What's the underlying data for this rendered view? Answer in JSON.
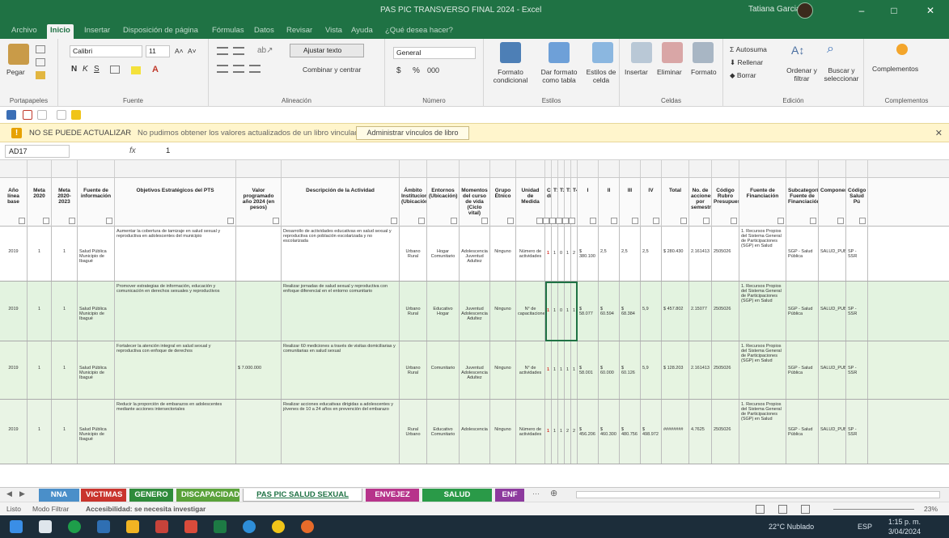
{
  "app": {
    "window_title": "PAS PIC TRANSVERSO FINAL 2024 - Excel",
    "user_name": "Tatiana Garcia",
    "window_controls": [
      "–",
      "□",
      "✕"
    ]
  },
  "ribbon_tabs": [
    "Archivo",
    "Inicio",
    "Insertar",
    "Disposición de página",
    "Fórmulas",
    "Datos",
    "Revisar",
    "Vista",
    "Ayuda",
    "¿Qué desea hacer?"
  ],
  "ribbon": {
    "clipboard": {
      "paste": "Pegar",
      "label": "Portapapeles"
    },
    "font": {
      "name": "Calibri",
      "size": "11",
      "bold": "N",
      "italic": "K",
      "underline": "S",
      "label": "Fuente"
    },
    "alignment": {
      "wrap": "Ajustar texto",
      "merge": "Combinar y centrar",
      "label": "Alineación"
    },
    "number": {
      "format": "General",
      "currency": "$",
      "percent": "%",
      "thousands": "000",
      "label": "Número"
    },
    "styles": {
      "conditional": "Formato condicional",
      "as_table": "Dar formato como tabla",
      "cell_styles": "Estilos de celda",
      "label": "Estilos"
    },
    "cells": {
      "insert": "Insertar",
      "delete": "Eliminar",
      "format": "Formato",
      "label": "Celdas"
    },
    "editing": {
      "autosum": "Autosuma",
      "fill": "Rellenar",
      "clear": "Borrar",
      "sort": "Ordenar y filtrar",
      "find": "Buscar y seleccionar",
      "label": "Edición"
    },
    "addins": {
      "button": "Complementos",
      "label": "Complementos"
    }
  },
  "warning": {
    "title": "NO SE PUEDE ACTUALIZAR",
    "message": "No pudimos obtener los valores actualizados de un libro vinculado.",
    "button": "Administrar vínculos de libro"
  },
  "formula_bar": {
    "cell_ref": "AD17",
    "fx": "fx",
    "value": "1"
  },
  "columns": [
    {
      "header": "Año línea base"
    },
    {
      "header": "Meta 2020"
    },
    {
      "header": "Meta 2020-2023"
    },
    {
      "header": "Fuente de información"
    },
    {
      "header": "Objetivos Estratégicos del PTS"
    },
    {
      "header": "Valor programado año 2024 (en pesos)"
    },
    {
      "header": "Descripción de la Actividad"
    },
    {
      "header": "Ámbito Institucional (Ubicación)"
    },
    {
      "header": "Entornos (Ubicación)"
    },
    {
      "header": "Momentos del curso de vida (Ciclo vital)"
    },
    {
      "header": "Grupo Étnico"
    },
    {
      "header": "Unidad de Medida"
    },
    {
      "header": "Cant. día"
    },
    {
      "header": "T1"
    },
    {
      "header": "T2"
    },
    {
      "header": "T3"
    },
    {
      "header": "T4"
    },
    {
      "header": "I"
    },
    {
      "header": "II"
    },
    {
      "header": "III"
    },
    {
      "header": "IV"
    },
    {
      "header": "Total"
    },
    {
      "header": "No. de acciones por semestre"
    },
    {
      "header": "Código Rubro Presupuestal"
    },
    {
      "header": "Fuente de Financiación"
    },
    {
      "header": "Subcategoría Fuente de Financiación"
    },
    {
      "header": "Componente"
    },
    {
      "header": "Código Salud Pú"
    }
  ],
  "rows": [
    {
      "year": "2019",
      "meta": "1",
      "meta2": "1",
      "source": "Salud Pública Municipio de Ibagué",
      "objective": "Aumentar la cobertura de tamizaje en salud sexual y reproductiva en adolescentes del municipio",
      "value": "",
      "activity": "Desarrollo de actividades educativas en salud sexual y reproductiva con población escolarizada y no escolarizada",
      "ambit": "Urbano Rural",
      "env": "Hogar Comunitario",
      "life": "Adolescencia Juventud Adultez",
      "ethnic": "Ninguno",
      "unit": "Número de actividades",
      "red": "1",
      "q": [
        "1",
        "0",
        "1",
        "2"
      ],
      "i": "$ 380.100",
      "ii": "2,5",
      "iii": "2,5",
      "iv": "2,5",
      "total": "$ 280.430",
      "acc": "2.161413",
      "code": "2505026",
      "fund": "1. Recursos Propios del Sistema General de Participaciones (SGP) en Salud",
      "sub": "SGP - Salud Pública",
      "comp": "SALUD_PUBLICA",
      "cod": "SP - SSR"
    },
    {
      "year": "2019",
      "meta": "1",
      "meta2": "1",
      "source": "Salud Pública Municipio de Ibagué",
      "objective": "Promover estrategias de información, educación y comunicación en derechos sexuales y reproductivos",
      "value": "",
      "activity": "Realizar jornadas de salud sexual y reproductiva con enfoque diferencial en el entorno comunitario",
      "ambit": "Urbano Rural",
      "env": "Educativo Hogar",
      "life": "Juventud Adolescencia Adultez",
      "ethnic": "Ninguno",
      "unit": "N° de capacitaciones",
      "red": "1",
      "q": [
        "1",
        "0",
        "1",
        "1"
      ],
      "i": "$ 58.077",
      "ii": "$ 60.594",
      "iii": "$ 68.384",
      "iv": "5,9",
      "total": "$ 457.802",
      "acc": "2.15077",
      "code": "2505026",
      "fund": "1. Recursos Propios del Sistema General de Participaciones (SGP) en Salud",
      "sub": "SGP - Salud Pública",
      "comp": "SALUD_PUBLICA",
      "cod": "SP - SSR"
    },
    {
      "year": "2019",
      "meta": "1",
      "meta2": "1",
      "source": "Salud Pública Municipio de Ibagué",
      "objective": "Fortalecer la atención integral en salud sexual y reproductiva con enfoque de derechos",
      "value": "$ 7.000.000",
      "activity": "Realizar 60 mediciones a través de visitas domiciliarias y comunitarias en salud sexual",
      "ambit": "Urbano Rural",
      "env": "Comunitario",
      "life": "Juventud Adolescencia Adultez",
      "ethnic": "Ninguno",
      "unit": "N° de actividades",
      "red": "1",
      "q": [
        "1",
        "1",
        "1",
        "1"
      ],
      "i": "$ 58.001",
      "ii": "$ 60.000",
      "iii": "$ 60.126",
      "iv": "5,9",
      "total": "$ 128.203",
      "acc": "2.161413",
      "code": "2505026",
      "fund": "1. Recursos Propios del Sistema General de Participaciones (SGP) en Salud",
      "sub": "SGP - Salud Pública",
      "comp": "SALUD_PUBLICA",
      "cod": "SP - SSR"
    },
    {
      "year": "2019",
      "meta": "1",
      "meta2": "1",
      "source": "Salud Pública Municipio de Ibagué",
      "objective": "Reducir la proporción de embarazos en adolescentes mediante acciones intersectoriales",
      "value": "",
      "activity": "Realizar acciones educativas dirigidas a adolescentes y jóvenes de 10 a 24 años en prevención del embarazo",
      "ambit": "Rural Urbano",
      "env": "Educativo Comunitario",
      "life": "Adolescencia",
      "ethnic": "Ninguno",
      "unit": "Número de actividades",
      "red": "1",
      "q": [
        "1",
        "1",
        "2",
        "2"
      ],
      "i": "$ 456.206",
      "ii": "$ 460.300",
      "iii": "$ 480.756",
      "iv": "$ 498.972",
      "total": "########",
      "acc": "4.7625",
      "code": "2505026",
      "fund": "1. Recursos Propios del Sistema General de Participaciones (SGP) en Salud",
      "sub": "SGP - Salud Pública",
      "comp": "SALUD_PUBLICA",
      "cod": "SP - SSR"
    }
  ],
  "red_text_note": "DESPROGRAMADA JEFE DANIELA",
  "sheet_tabs": [
    {
      "label": "NNA",
      "color": "#4a8fc9"
    },
    {
      "label": "VICTIMAS",
      "color": "#c9342d"
    },
    {
      "label": "GENERO",
      "color": "#2f8b3b"
    },
    {
      "label": "DISCAPACIDAD",
      "color": "#5aa23a"
    },
    {
      "label": "PAS PIC SALUD SEXUAL",
      "color": "#ffffff"
    },
    {
      "label": "ENVEJEZ",
      "color": "#b7348b"
    },
    {
      "label": "SALUD MENTAL",
      "color": "#2a9a48"
    },
    {
      "label": "ENF",
      "color": "#8d3a9e"
    }
  ],
  "status": {
    "ready": "Listo",
    "filter_mode": "Modo Filtrar",
    "accessibility": "Accesibilidad: se necesita investigar",
    "zoom": "23%"
  },
  "taskbar": {
    "weather": "22°C Nublado",
    "lang": "ESP",
    "time": "1:15 p. m.",
    "date": "3/04/2024"
  }
}
